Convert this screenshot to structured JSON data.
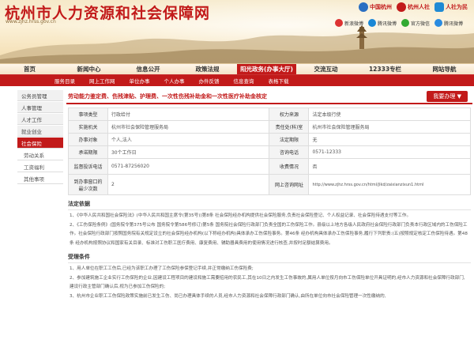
{
  "header": {
    "title": "杭州市人力资源和社会保障网",
    "url": "www.zjhz.hrss.gov.cn",
    "logos": [
      "中国杭州",
      "杭州人社",
      "人社为民"
    ],
    "social": [
      {
        "label": "新浪微博",
        "cls": "wb"
      },
      {
        "label": "腾讯微博",
        "cls": "tx"
      },
      {
        "label": "官方微信",
        "cls": "wx"
      },
      {
        "label": "腾讯微博",
        "cls": "qq"
      }
    ]
  },
  "nav": {
    "items": [
      "首页",
      "新闻中心",
      "信息公开",
      "政策法规",
      "阳光政务(办事大厅)",
      "交流互动",
      "12333专栏",
      "网站导航"
    ],
    "active_index": 4
  },
  "subnav": [
    "服务目录",
    "网上工作网",
    "单位办事",
    "个人办事",
    "办件反馈",
    "信息查询",
    "表格下载"
  ],
  "sidebar": {
    "items": [
      {
        "label": "公务员管理",
        "state": ""
      },
      {
        "label": "人事管理",
        "state": ""
      },
      {
        "label": "人才工作",
        "state": ""
      },
      {
        "label": "就业创业",
        "state": ""
      },
      {
        "label": "社会保险",
        "state": "active"
      },
      {
        "label": "劳动关系",
        "state": "sub"
      },
      {
        "label": "工资福利",
        "state": "sub"
      },
      {
        "label": "其他事项",
        "state": "sub"
      }
    ]
  },
  "panel": {
    "title": "劳动能力鉴定费、伤残津贴、护理费、一次性伤残补助金和一次性医疗补助金核定",
    "apply_label": "我要办理 ▼",
    "rows": [
      {
        "k1": "事项类型",
        "v1": "行政给付",
        "k2": "权力来源",
        "v2": "法定本级行使"
      },
      {
        "k1": "实施机关",
        "v1": "杭州市社会保险管理服务局",
        "k2": "责任处(科)室",
        "v2": "杭州市社会保险管理服务局"
      },
      {
        "k1": "办事对象",
        "v1": "个人,法人",
        "k2": "法定期限",
        "v2": "无"
      },
      {
        "k1": "承诺期限",
        "v1": "30个工作日",
        "k2": "咨询电话",
        "v2": "0571-12333"
      },
      {
        "k1": "监督投诉电话",
        "v1": "0571-87256020",
        "k2": "收费情况",
        "v2": "否"
      },
      {
        "k1": "到办事窗口的最少次数",
        "v1": "2",
        "k2": "网上咨询网址",
        "v2": "http://www.zjhz.hrss.gov.cn/html/jlkd/zaixianzixun1.html"
      }
    ],
    "basis_title": "法定依据",
    "basis": [
      "1、《中华人民共和国社会保险法》(中华人民共和国主席令(第35号))第8条 社会保险经办机构提供社会保险服务,负责社会保险登记、个人权益记录、社会保险待遇支付等工作。",
      "2、《工伤保险条例》(国务院令第375号公布 国务院令第586号修订)第5条 国务院社会保险行政部门负责全国的工伤保险工作。县级以上地方各级人民政府社会保险行政部门负责本行政区域内的工伤保险工作。社会保险行政部门按照国务院有关规定设立的社会保险经办机构(以下称经办机构)具体承办工伤保险事务。第46条 经办机构具体承办工伤保险事务,履行下列职责:(五)按照规定核定工伤保险待遇。第48条 经办机构按照协议和国家有关目录、标准对工伤职工医疗费用、康复费用、辅助器具费用的使用情况进行核查,并按时足额结算费用。"
    ],
    "cond_title": "受理条件",
    "cond": [
      "1、用人单位在职工工伤后,已经为该职工办理了工伤保险参保登记手续,并正常缴纳工伤保险费;",
      "2、参加建筑施工企业实行工伤保险的企业,因建设工程项目的建设和施工需要招用的农民工,其在10日之内发生工伤事故的,属用人单位按月向市工伤保险单位开具证明的,经市人力资源和社会保障行政部门,建设行政主管部门确认后,视为已参加工伤保险的;",
      "3、杭州市企业职工工伤保险政策实施前已发生工伤、尚已办理具体手续的人员,经市人力资源和社会保障行政部门确认,由所在单位向市社会保险管理一次性缴纳的,"
    ]
  }
}
